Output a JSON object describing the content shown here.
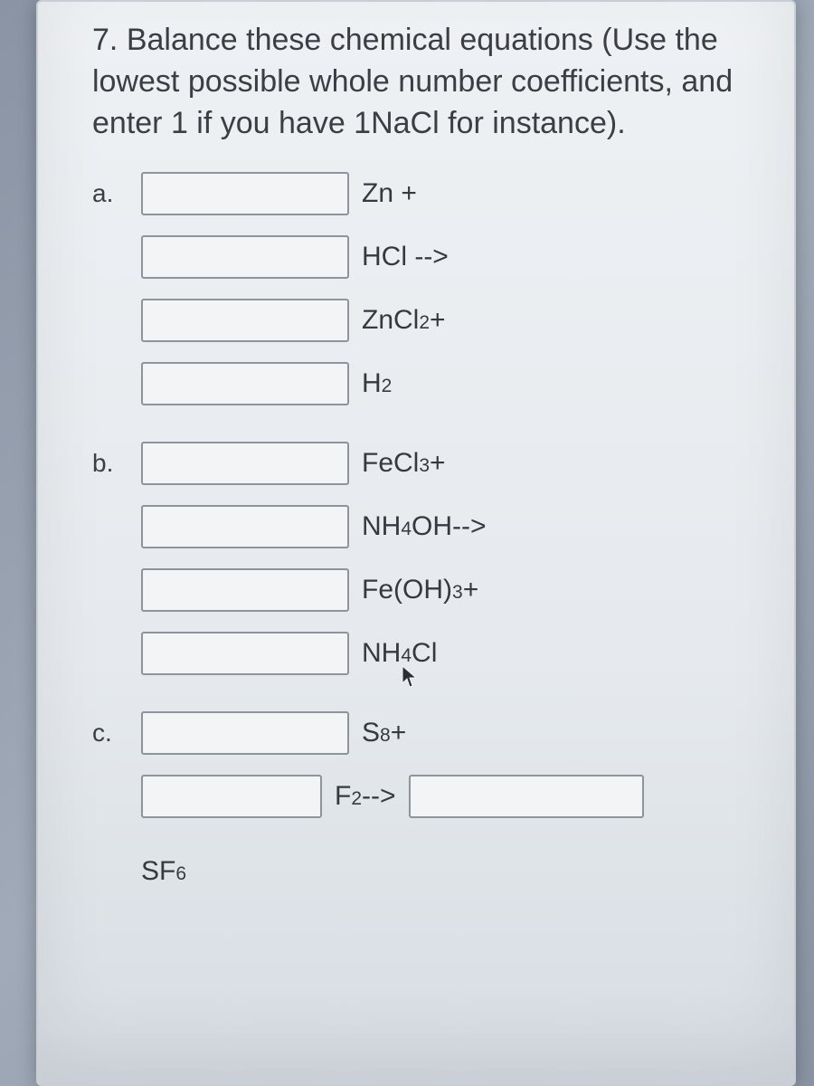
{
  "question": {
    "number": "7.",
    "text": "Balance these chemical equations (Use the lowest possible whole number coefficients, and enter 1 if you have 1NaCl for instance)."
  },
  "parts": {
    "a": {
      "label": "a.",
      "terms": [
        "Zn +",
        "HCl -->",
        "ZnCl₂ +",
        "H₂"
      ]
    },
    "b": {
      "label": "b.",
      "terms": [
        "FeCl₃  +",
        "NH₄OH-->",
        "Fe(OH)₃ +",
        "NH₄Cl"
      ]
    },
    "c": {
      "label": "c.",
      "terms": [
        "S₈ +",
        "F₂ -->"
      ],
      "final": "SF₆"
    }
  },
  "chem": {
    "a1_a": "Zn +",
    "a2_a": "HCl -->",
    "a3_a": "ZnCl",
    "a3_sub": "2",
    "a3_b": " +",
    "a4_a": "H",
    "a4_sub": "2",
    "b1_a": "FeCl",
    "b1_sub": "3",
    "b1_b": "  +",
    "b2_a": "NH",
    "b2_sub": "4",
    "b2_b": "OH-->",
    "b3_a": "Fe(OH)",
    "b3_sub": "3",
    "b3_b": " +",
    "b4_a": "NH",
    "b4_sub": "4",
    "b4_b": "Cl",
    "c1_a": "S",
    "c1_sub": "8",
    "c1_b": " +",
    "c2_a": "F",
    "c2_sub": "2",
    "c2_b": " -->",
    "c3_a": "SF",
    "c3_sub": "6"
  }
}
